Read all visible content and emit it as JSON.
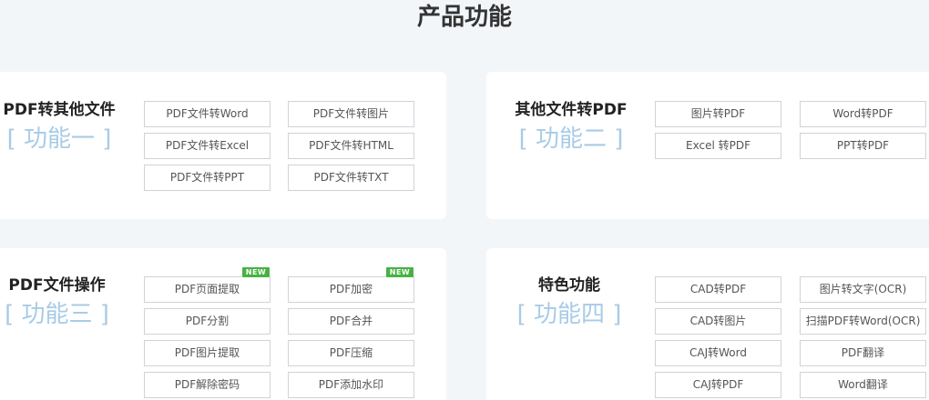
{
  "page_title": "产品功能",
  "cards": [
    {
      "title": "PDF转其他文件",
      "subtitle": "[ 功能一 ]",
      "buttons": [
        "PDF文件转Word",
        "PDF文件转图片",
        "PDF文件转Excel",
        "PDF文件转HTML",
        "PDF文件转PPT",
        "PDF文件转TXT"
      ]
    },
    {
      "title": "其他文件转PDF",
      "subtitle": "[ 功能二 ]",
      "buttons": [
        "图片转PDF",
        "Word转PDF",
        "Excel 转PDF",
        "PPT转PDF"
      ]
    },
    {
      "title": "PDF文件操作",
      "subtitle": "[ 功能三 ]",
      "buttons": [
        "PDF页面提取",
        "PDF加密",
        "PDF分割",
        "PDF合并",
        "PDF图片提取",
        "PDF压缩",
        "PDF解除密码",
        "PDF添加水印"
      ],
      "badge": "NEW"
    },
    {
      "title": "特色功能",
      "subtitle": "[ 功能四 ]",
      "buttons": [
        "CAD转PDF",
        "图片转文字(OCR)",
        "CAD转图片",
        "扫描PDF转Word(OCR)",
        "CAJ转Word",
        "PDF翻译",
        "CAJ转PDF",
        "Word翻译"
      ]
    }
  ]
}
